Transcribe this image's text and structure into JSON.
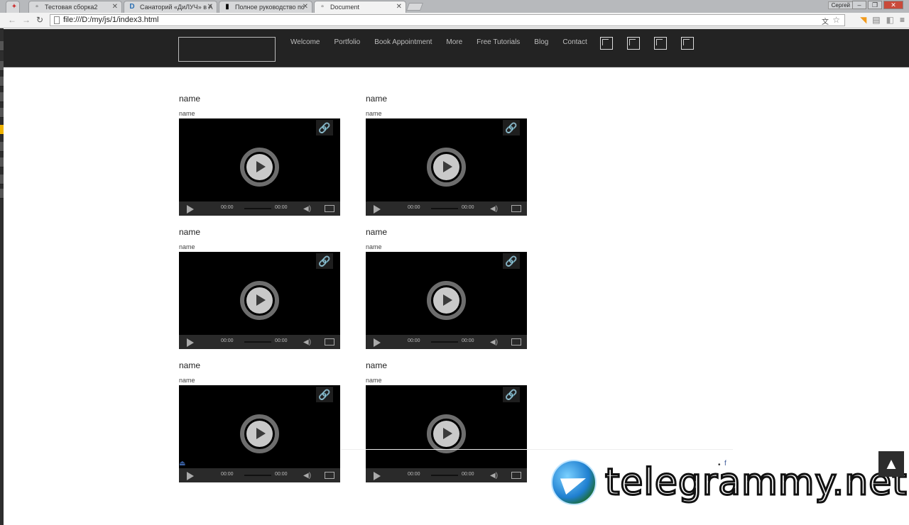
{
  "browser": {
    "tabs": [
      {
        "label": "Тестовая сборка2",
        "icon": "page-icon"
      },
      {
        "label": "Санаторий «ДиЛУЧ» в А",
        "icon": "d-logo-icon"
      },
      {
        "label": "Полное руководство по",
        "icon": "book-icon"
      },
      {
        "label": "Document",
        "icon": "page-icon"
      }
    ],
    "user_label": "Сергей",
    "url": "file:///D:/my/js/1/index3.html"
  },
  "site": {
    "nav": [
      "Welcome",
      "Portfolio",
      "Book Appointment",
      "More",
      "Free Tutorials",
      "Blog",
      "Contact"
    ],
    "cards": [
      {
        "title": "name",
        "subtitle": "name",
        "time_current": "00:00",
        "time_total": "00:00"
      },
      {
        "title": "name",
        "subtitle": "name",
        "time_current": "00:00",
        "time_total": "00:00"
      },
      {
        "title": "name",
        "subtitle": "name",
        "time_current": "00:00",
        "time_total": "00:00"
      },
      {
        "title": "name",
        "subtitle": "name",
        "time_current": "00:00",
        "time_total": "00:00"
      },
      {
        "title": "name",
        "subtitle": "name",
        "time_current": "00:00",
        "time_total": "00:00"
      },
      {
        "title": "name",
        "subtitle": "name",
        "time_current": "00:00",
        "time_total": "00:00"
      }
    ],
    "footer_social": "f"
  },
  "watermark": "telegrammy.net"
}
